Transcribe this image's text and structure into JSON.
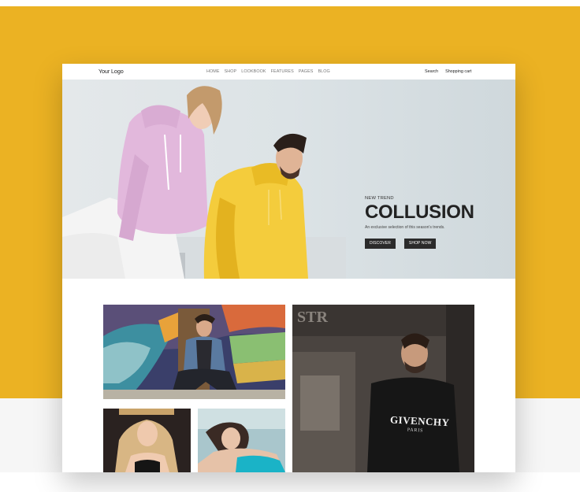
{
  "nav": {
    "logo": "Your Logo",
    "menu": [
      "HOME",
      "SHOP",
      "LOOKBOOK",
      "FEATURES",
      "PAGES",
      "BLOG"
    ],
    "search_label": "Search",
    "cart_label": "Shopping cart"
  },
  "hero": {
    "eyebrow": "NEW TREND",
    "headline": "COLLUSION",
    "subline": "An exclusive selection of this season's trends.",
    "discover_label": "DISCOVER",
    "shop_now_label": "SHOP NOW"
  },
  "gallery": {
    "shirt_text": "GIVENCHY",
    "shirt_subtext": "PARIS"
  },
  "colors": {
    "backdrop": "#ebb223",
    "button": "#2b2b2b",
    "hoodie_pink": "#e2b8dc",
    "hoodie_yellow": "#f4cc3c"
  }
}
